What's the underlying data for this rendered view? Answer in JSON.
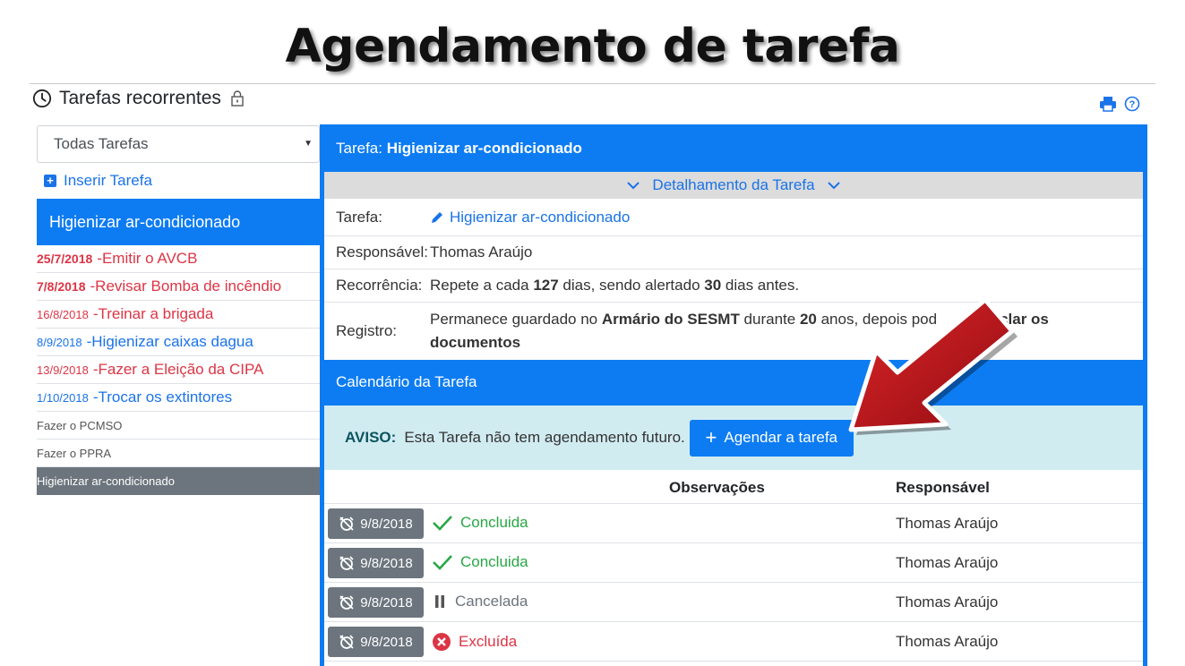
{
  "banner": {
    "title": "Agendamento de tarefa"
  },
  "header": {
    "title": "Tarefas recorrentes",
    "icons": [
      "clock-icon",
      "lock-icon",
      "print-icon",
      "help-icon"
    ]
  },
  "sidebar": {
    "filter": "Todas Tarefas",
    "insert_label": "Inserir Tarefa",
    "active_task": "Higienizar ar-condicionado",
    "items": [
      {
        "date": "25/7/2018",
        "sep": " - ",
        "name": "Emitir o AVCB"
      },
      {
        "date": "7/8/2018",
        "sep": " - ",
        "name": "Revisar Bomba de incêndio"
      },
      {
        "date": "16/8/2018",
        "sep": " - ",
        "name": "Treinar a brigada"
      },
      {
        "date": "8/9/2018",
        "sep": " - ",
        "name": "Higienizar caixas dagua"
      },
      {
        "date": "13/9/2018",
        "sep": " - ",
        "name": "Fazer a Eleição da CIPA"
      },
      {
        "date": "1/10/2018",
        "sep": " - ",
        "name": "Trocar os extintores"
      },
      {
        "name": "Fazer o PCMSO"
      },
      {
        "name": "Fazer o PPRA"
      },
      {
        "name": "Higienizar ar-condicionado"
      }
    ]
  },
  "panel": {
    "task_prefix": "Tarefa:",
    "task_name": "Higienizar ar-condicionado",
    "detail_toggle": "Detalhamento da Tarefa",
    "details": {
      "tarefa_label": "Tarefa:",
      "tarefa_value": "Higienizar ar-condicionado",
      "resp_label": "Responsável:",
      "resp_value": "Thomas Araújo",
      "rec_label": "Recorrência:",
      "rec_1": "Repete a cada ",
      "rec_days": "127",
      "rec_2": " dias, sendo alertado ",
      "rec_alert": "30",
      "rec_3": " dias antes.",
      "reg_label": "Registro:",
      "reg_1": "Permanece guardado no ",
      "reg_place": "Armário do SESMT",
      "reg_2": " durante ",
      "reg_years": "20",
      "reg_3": " anos, depois pod",
      "reg_4": "clar os",
      "reg_5": "documentos"
    },
    "calendar_title": "Calendário da Tarefa",
    "aviso_label": "AVISO:",
    "aviso_text": "Esta Tarefa não tem agendamento futuro.",
    "schedule_button": "Agendar a tarefa",
    "table": {
      "col_obs": "Observações",
      "col_resp": "Responsável",
      "rows": [
        {
          "date": "9/8/2018",
          "status": "Concluida",
          "resp": "Thomas Araújo"
        },
        {
          "date": "9/8/2018",
          "status": "Concluida",
          "resp": "Thomas Araújo"
        },
        {
          "date": "9/8/2018",
          "status": "Cancelada",
          "resp": "Thomas Araújo"
        },
        {
          "date": "9/8/2018",
          "status": "Excluída",
          "resp": "Thomas Araújo"
        }
      ]
    }
  },
  "colors": {
    "primary": "#0d7cf2",
    "danger": "#dc3545",
    "success": "#28a745",
    "info_bg": "#d1ecf1",
    "arrow": "#c4161c"
  }
}
